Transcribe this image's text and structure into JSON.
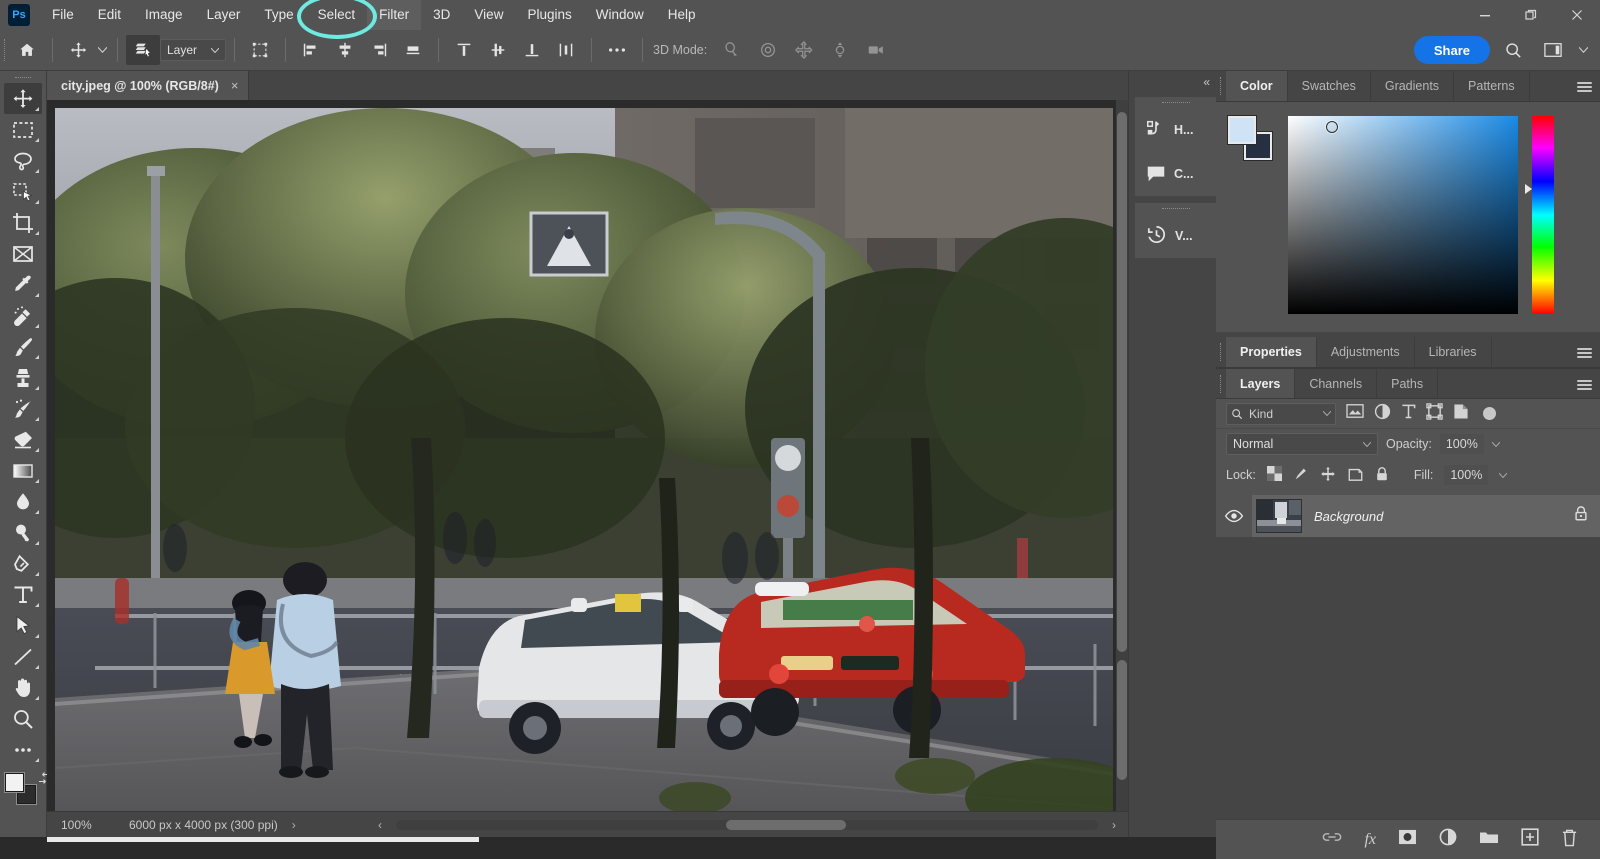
{
  "app": {
    "name": "Adobe Photoshop",
    "logo_text": "Ps"
  },
  "menubar": {
    "items": [
      {
        "label": "File",
        "hovered": false
      },
      {
        "label": "Edit",
        "hovered": false
      },
      {
        "label": "Image",
        "hovered": false
      },
      {
        "label": "Layer",
        "hovered": false
      },
      {
        "label": "Type",
        "hovered": false
      },
      {
        "label": "Select",
        "hovered": false
      },
      {
        "label": "Filter",
        "hovered": true
      },
      {
        "label": "3D",
        "hovered": false
      },
      {
        "label": "View",
        "hovered": false
      },
      {
        "label": "Plugins",
        "hovered": false
      },
      {
        "label": "Window",
        "hovered": false
      },
      {
        "label": "Help",
        "hovered": false
      }
    ],
    "annotation": {
      "target": "Filter",
      "shape": "ellipse",
      "color": "#6feae0"
    },
    "window_controls": {
      "minimize": "Minimize",
      "restore": "Restore",
      "close": "Close"
    }
  },
  "options_bar": {
    "home_label": "Home",
    "tool_label": "Move Tool",
    "auto_select_label": "Auto-Select",
    "auto_select_value": "Layer",
    "show_transform_label": "Show Transform Controls",
    "align_labels": [
      "Align left edges",
      "Align horizontal centers",
      "Align right edges",
      "Align bottom edges"
    ],
    "distribute_labels": [
      "Distribute top edges",
      "Distribute vertical centers",
      "Distribute bottom edges",
      "Distribute horizontal centers"
    ],
    "more_label": "More options",
    "three_d_mode_label": "3D Mode:",
    "three_d_tools": [
      "Rotate the 3D Object",
      "Roll the 3D Object",
      "Drag the 3D Object",
      "Slide the 3D Object",
      "Scale the 3D Object"
    ],
    "share_label": "Share",
    "search_label": "Search",
    "workspace_label": "Workspace"
  },
  "toolbar": {
    "tools": [
      {
        "name": "move-tool",
        "label": "Move Tool",
        "active": true,
        "has_flyout": true
      },
      {
        "name": "marquee-tool",
        "label": "Rectangular Marquee Tool",
        "active": false,
        "has_flyout": true
      },
      {
        "name": "lasso-tool",
        "label": "Lasso Tool",
        "active": false,
        "has_flyout": true
      },
      {
        "name": "object-selection-tool",
        "label": "Object Selection Tool",
        "active": false,
        "has_flyout": true
      },
      {
        "name": "crop-tool",
        "label": "Crop Tool",
        "active": false,
        "has_flyout": true
      },
      {
        "name": "frame-tool",
        "label": "Frame Tool",
        "active": false,
        "has_flyout": false
      },
      {
        "name": "eyedropper-tool",
        "label": "Eyedropper Tool",
        "active": false,
        "has_flyout": true
      },
      {
        "name": "healing-brush-tool",
        "label": "Spot Healing Brush Tool",
        "active": false,
        "has_flyout": true
      },
      {
        "name": "brush-tool",
        "label": "Brush Tool",
        "active": false,
        "has_flyout": true
      },
      {
        "name": "clone-stamp-tool",
        "label": "Clone Stamp Tool",
        "active": false,
        "has_flyout": true
      },
      {
        "name": "history-brush-tool",
        "label": "History Brush Tool",
        "active": false,
        "has_flyout": true
      },
      {
        "name": "eraser-tool",
        "label": "Eraser Tool",
        "active": false,
        "has_flyout": true
      },
      {
        "name": "gradient-tool",
        "label": "Gradient Tool",
        "active": false,
        "has_flyout": true
      },
      {
        "name": "blur-tool",
        "label": "Blur Tool",
        "active": false,
        "has_flyout": true
      },
      {
        "name": "dodge-tool",
        "label": "Dodge Tool",
        "active": false,
        "has_flyout": true
      },
      {
        "name": "pen-tool",
        "label": "Pen Tool",
        "active": false,
        "has_flyout": true
      },
      {
        "name": "type-tool",
        "label": "Horizontal Type Tool",
        "active": false,
        "has_flyout": true
      },
      {
        "name": "path-selection-tool",
        "label": "Path Selection Tool",
        "active": false,
        "has_flyout": true
      },
      {
        "name": "line-tool",
        "label": "Line Tool",
        "active": false,
        "has_flyout": true
      },
      {
        "name": "hand-tool",
        "label": "Hand Tool",
        "active": false,
        "has_flyout": true
      },
      {
        "name": "zoom-tool",
        "label": "Zoom Tool",
        "active": false,
        "has_flyout": false
      },
      {
        "name": "edit-toolbar-button",
        "label": "Edit Toolbar",
        "active": false,
        "has_flyout": true
      }
    ],
    "foreground_color": "#f2f2f2",
    "background_color": "#2c2c2c",
    "swap_colors_label": "Switch Foreground and Background Colors"
  },
  "document": {
    "tab_title": "city.jpeg @ 100% (RGB/8#)",
    "close_label": "×"
  },
  "status_bar": {
    "zoom": "100%",
    "dimensions": "6000 px x 4000 px (300 ppi)",
    "expand_arrow": "›",
    "left_chevron": "‹",
    "right_chevron": "›"
  },
  "icon_dock": {
    "collapse_label": "«",
    "expand_label": "^",
    "items": [
      {
        "name": "histogram-panel",
        "label": "H...",
        "icon": "histogram-icon"
      },
      {
        "name": "comments-panel",
        "label": "C...",
        "icon": "comment-icon"
      },
      {
        "name": "version-history-panel",
        "label": "V...",
        "icon": "clock-history-icon"
      }
    ]
  },
  "color_panel": {
    "tabs": [
      {
        "label": "Color",
        "active": true
      },
      {
        "label": "Swatches",
        "active": false
      },
      {
        "label": "Gradients",
        "active": false
      },
      {
        "label": "Patterns",
        "active": false
      }
    ],
    "menu_label": "Color panel menu",
    "foreground_color": "#cfe3f7",
    "background_color": "#273041",
    "picker_type": "hue-cube"
  },
  "properties_panel": {
    "tabs": [
      {
        "label": "Properties",
        "active": true
      },
      {
        "label": "Adjustments",
        "active": false
      },
      {
        "label": "Libraries",
        "active": false
      }
    ],
    "menu_label": "Properties panel menu"
  },
  "layers_panel": {
    "tabs": [
      {
        "label": "Layers",
        "active": true
      },
      {
        "label": "Channels",
        "active": false
      },
      {
        "label": "Paths",
        "active": false
      }
    ],
    "menu_label": "Layers panel menu",
    "filter_kind": "Kind",
    "filter_icons": [
      "pixel-layer-filter",
      "adjustment-layer-filter",
      "type-layer-filter",
      "shape-layer-filter",
      "smart-object-filter"
    ],
    "filter_toggle_label": "Turn layer filtering on/off",
    "blend_mode": "Normal",
    "opacity_label": "Opacity:",
    "opacity_value": "100%",
    "lock_label": "Lock:",
    "lock_icons": [
      "lock-transparent-pixels",
      "lock-image-pixels",
      "lock-position",
      "lock-artboard-nesting",
      "lock-all"
    ],
    "fill_label": "Fill:",
    "fill_value": "100%",
    "layers": [
      {
        "name": "Background",
        "visible": true,
        "locked": true,
        "selected": true
      }
    ],
    "footer_buttons": [
      {
        "name": "link-layers-button",
        "label": "Link layers"
      },
      {
        "name": "layer-style-button",
        "label": "fx"
      },
      {
        "name": "add-layer-mask-button",
        "label": "Add layer mask"
      },
      {
        "name": "new-adjustment-layer-button",
        "label": "New fill or adjustment layer"
      },
      {
        "name": "new-group-button",
        "label": "Create a new group"
      },
      {
        "name": "new-layer-button",
        "label": "Create a new layer"
      },
      {
        "name": "delete-layer-button",
        "label": "Delete layer"
      }
    ]
  },
  "canvas": {
    "scene_description": "City street at dusk with pedestrians, a white sedan, a red taxi, trees and a crosswalk"
  }
}
